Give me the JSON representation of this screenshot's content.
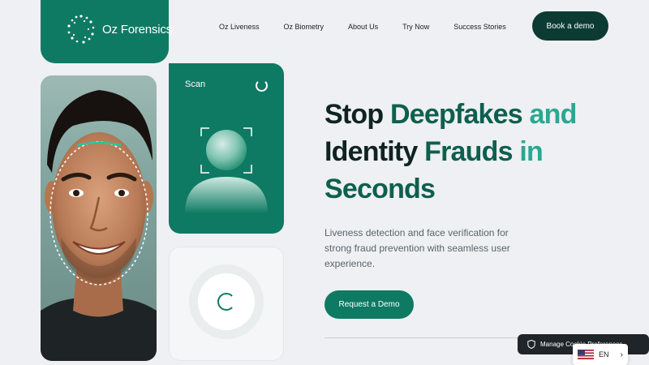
{
  "brand": {
    "name": "Oz Forensics"
  },
  "nav": {
    "items": [
      {
        "label": "Oz Liveness"
      },
      {
        "label": "Oz Biometry"
      },
      {
        "label": "About Us"
      },
      {
        "label": "Try Now"
      },
      {
        "label": "Success Stories"
      }
    ],
    "book_demo": "Book a demo"
  },
  "scan_card": {
    "label": "Scan"
  },
  "hero": {
    "title_line1_a": "Stop ",
    "title_line1_b": "Deepfakes ",
    "title_line1_c": "and",
    "title_line2_a": "Identity ",
    "title_line2_b": "Frauds ",
    "title_line2_c": "in",
    "title_line3": "Seconds",
    "subtitle": "Liveness detection and face verification for strong fraud prevention with seamless user experience.",
    "cta": "Request a Demo"
  },
  "cookie": {
    "label": "Manage Cookie Preferences"
  },
  "language": {
    "code": "EN"
  },
  "colors": {
    "brand_green": "#0f7a63",
    "dark_button": "#0b3b33",
    "accent_light": "#2aa891"
  }
}
